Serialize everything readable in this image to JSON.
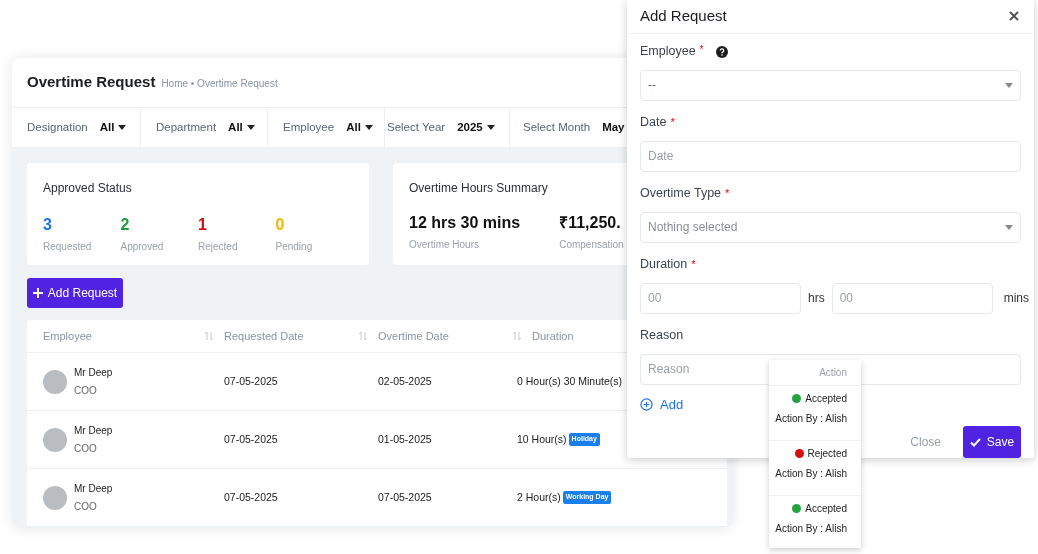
{
  "page": {
    "title": "Overtime Request",
    "breadcrumb": "Home • Overtime Request"
  },
  "filters": [
    {
      "label": "Designation",
      "value": "All"
    },
    {
      "label": "Department",
      "value": "All"
    },
    {
      "label": "Employee",
      "value": "All"
    },
    {
      "label": "Select Year",
      "value": "2025"
    },
    {
      "label": "Select Month",
      "value": "May"
    }
  ],
  "approved_status": {
    "title": "Approved Status",
    "items": [
      {
        "value": "3",
        "label": "Requested",
        "color": "#1a73e8"
      },
      {
        "value": "2",
        "label": "Approved",
        "color": "#1e9e3a"
      },
      {
        "value": "1",
        "label": "Rejected",
        "color": "#d10f0f"
      },
      {
        "value": "0",
        "label": "Pending",
        "color": "#f5b400"
      }
    ]
  },
  "hours_summary": {
    "title": "Overtime Hours Summary",
    "items": [
      {
        "value": "12 hrs 30 mins",
        "label": "Overtime Hours"
      },
      {
        "value": "₹11,250.",
        "label": "Compensation"
      }
    ]
  },
  "add_button": "Add Request",
  "table": {
    "columns": [
      {
        "label": "Employee",
        "sortable": true
      },
      {
        "label": "Requested Date",
        "sortable": true
      },
      {
        "label": "Overtime Date",
        "sortable": true
      },
      {
        "label": "Duration"
      }
    ],
    "rows": [
      {
        "name": "Mr Deep",
        "role": "COO",
        "requested": "07-05-2025",
        "overtime": "02-05-2025",
        "duration": "0 Hour(s) 30 Minute(s)"
      },
      {
        "name": "Mr Deep",
        "role": "COO",
        "requested": "07-05-2025",
        "overtime": "01-05-2025",
        "duration": "10 Hour(s)",
        "tag": "Holiday"
      },
      {
        "name": "Mr Deep",
        "role": "COO",
        "requested": "07-05-2025",
        "overtime": "07-05-2025",
        "duration": "2 Hour(s)",
        "tag": "Working Day"
      }
    ]
  },
  "modal": {
    "title": "Add Request",
    "fields": [
      {
        "kind": "select",
        "label": "Employee",
        "required_mark": "*",
        "help": true,
        "value": "--"
      },
      {
        "kind": "input",
        "label": "Date",
        "required_mark": "*",
        "placeholder": "Date"
      },
      {
        "kind": "select",
        "label": "Overtime Type",
        "required_mark": "*",
        "placeholder": "Nothing selected"
      },
      {
        "kind": "duration",
        "label": "Duration",
        "required_mark": "*",
        "hours_placeholder": "00",
        "hours_unit": "hrs",
        "minutes_placeholder": "00",
        "minutes_unit": "mins"
      },
      {
        "kind": "input",
        "label": "Reason",
        "placeholder": "Reason"
      }
    ],
    "add_link": "Add",
    "close_button": "Close",
    "save_button": "Save"
  },
  "action_panel": {
    "header": "Action",
    "items": [
      {
        "status": "Accepted",
        "color": "#23a33f",
        "by": "Action By : Alish"
      },
      {
        "status": "Rejected",
        "color": "#d60d0d",
        "by": "Action By : Alish"
      },
      {
        "status": "Accepted",
        "color": "#23a33f",
        "by": "Action By : Alish"
      }
    ]
  }
}
